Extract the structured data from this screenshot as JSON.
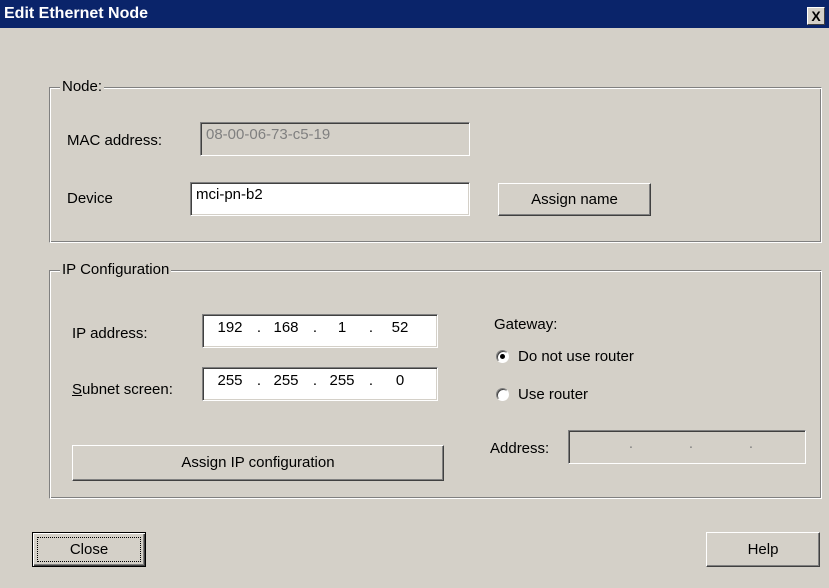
{
  "window": {
    "title": "Edit Ethernet Node",
    "close_glyph": "X"
  },
  "node_group": {
    "label": "Node:",
    "mac_label": "MAC address:",
    "mac_value": "08-00-06-73-c5-19",
    "device_label": "Device",
    "device_value": "mci-pn-b2",
    "assign_name_button": "Assign name"
  },
  "ip_group": {
    "label": "IP Configuration",
    "ip_label": "IP address:",
    "ip_octets": [
      "192",
      "168",
      "1",
      "52"
    ],
    "subnet_label_underlined": "S",
    "subnet_label_rest": "ubnet screen:",
    "subnet_octets": [
      "255",
      "255",
      "255",
      "0"
    ],
    "assign_ip_button": "Assign IP configuration",
    "gateway_label": "Gateway:",
    "radio_no_router": "Do not use router",
    "radio_use_router": "Use router",
    "selected_gateway_option": "Do not use router",
    "address_label": "Address:",
    "address_separator": "."
  },
  "footer": {
    "close_button": "Close",
    "help_button": "Help"
  }
}
